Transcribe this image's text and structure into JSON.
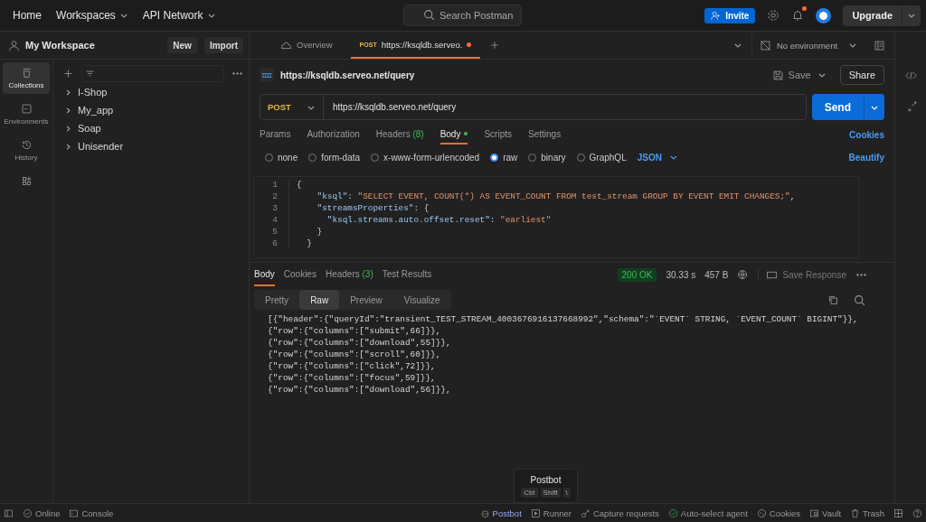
{
  "top_nav": {
    "links": [
      {
        "label": "Home",
        "dropdown": false
      },
      {
        "label": "Workspaces",
        "dropdown": true
      },
      {
        "label": "API Network",
        "dropdown": true
      }
    ],
    "search": {
      "placeholder": "Search Postman"
    },
    "invite": "Invite",
    "notifications_unread": true,
    "upgrade": "Upgrade"
  },
  "workspace": {
    "name": "My Workspace",
    "buttons": [
      "New",
      "Import"
    ]
  },
  "rail": [
    {
      "kind": "collections",
      "label": "Collections",
      "selected": true
    },
    {
      "kind": "environments",
      "label": "Environments",
      "selected": false
    },
    {
      "kind": "history",
      "label": "History",
      "selected": false
    },
    {
      "kind": "apps",
      "selected": false
    }
  ],
  "collections": [
    {
      "name": "I-Shop",
      "expanded": false
    },
    {
      "name": "My_app",
      "expanded": false
    },
    {
      "name": "Soap",
      "expanded": false
    },
    {
      "name": "Unisender",
      "expanded": false
    }
  ],
  "tabs": [
    {
      "kind": "overview",
      "label": "Overview",
      "selected": false
    },
    {
      "kind": "request",
      "method": "POST",
      "label": "https://ksqldb.serveo.",
      "unsaved": true,
      "selected": true
    }
  ],
  "environment": "No environment",
  "request": {
    "title": "https://ksqldb.serveo.net/query",
    "save": "Save",
    "share": "Share",
    "method": "POST",
    "url": "https://ksqldb.serveo.net/query",
    "send": "Send"
  },
  "request_tabs": [
    {
      "label": "Params",
      "selected": false
    },
    {
      "label": "Authorization",
      "selected": false
    },
    {
      "label": "Headers",
      "count": "(8)",
      "selected": false
    },
    {
      "label": "Body",
      "dot": true,
      "selected": true
    },
    {
      "label": "Scripts",
      "selected": false
    },
    {
      "label": "Settings",
      "selected": false
    }
  ],
  "cookies_link": "Cookies",
  "body_types": [
    {
      "label": "none",
      "selected": false
    },
    {
      "label": "form-data",
      "selected": false
    },
    {
      "label": "x-www-form-urlencoded",
      "selected": false
    },
    {
      "label": "raw",
      "selected": true
    },
    {
      "label": "binary",
      "selected": false
    },
    {
      "label": "GraphQL",
      "selected": false
    }
  ],
  "body_format": "JSON",
  "beautify": "Beautify",
  "code_lines": [
    {
      "number": "1",
      "tokens": [
        {
          "kind": "punct",
          "text": "{"
        }
      ]
    },
    {
      "number": "2",
      "tokens": [
        {
          "kind": "key",
          "text": "    \"ksql\""
        },
        {
          "kind": "punct",
          "text": ": "
        },
        {
          "kind": "string",
          "text": "\"SELECT EVENT, COUNT(*) AS EVENT_COUNT FROM test_stream GROUP BY EVENT EMIT CHANGES;\""
        },
        {
          "kind": "punct",
          "text": ","
        }
      ]
    },
    {
      "number": "3",
      "tokens": [
        {
          "kind": "key",
          "text": "    \"streamsProperties\""
        },
        {
          "kind": "punct",
          "text": ": {"
        }
      ]
    },
    {
      "number": "4",
      "tokens": [
        {
          "kind": "key",
          "text": "      \"ksql.streams.auto.offset.reset\""
        },
        {
          "kind": "punct",
          "text": ": "
        },
        {
          "kind": "string",
          "text": "\"earliest\""
        }
      ]
    },
    {
      "number": "5",
      "tokens": [
        {
          "kind": "punct",
          "text": "    }"
        }
      ]
    },
    {
      "number": "6",
      "tokens": [
        {
          "kind": "punct",
          "text": "  }"
        }
      ]
    }
  ],
  "response_tabs": [
    {
      "label": "Body",
      "selected": true
    },
    {
      "label": "Cookies",
      "selected": false
    },
    {
      "label": "Headers",
      "count": "(3)",
      "selected": false
    },
    {
      "label": "Test Results",
      "selected": false
    }
  ],
  "response_status": {
    "code": "200 OK",
    "time": "30.33 s",
    "size": "457 B",
    "save": "Save Response"
  },
  "view_tabs": [
    {
      "label": "Pretty",
      "selected": false
    },
    {
      "label": "Raw",
      "selected": true
    },
    {
      "label": "Preview",
      "selected": false
    },
    {
      "label": "Visualize",
      "selected": false
    }
  ],
  "response_lines": [
    "[{\"header\":{\"queryId\":\"transient_TEST_STREAM_4003676916137668992\",\"schema\":\"`EVENT` STRING, `EVENT_COUNT` BIGINT\"}},",
    "{\"row\":{\"columns\":[\"submit\",66]}},",
    "{\"row\":{\"columns\":[\"download\",55]}},",
    "{\"row\":{\"columns\":[\"scroll\",60]}},",
    "{\"row\":{\"columns\":[\"click\",72]}},",
    "{\"row\":{\"columns\":[\"focus\",59]}},",
    "{\"row\":{\"columns\":[\"download\",56]}},"
  ],
  "tooltip": {
    "title": "Postbot",
    "keys": [
      "Ctrl",
      "Shift",
      "\\"
    ]
  },
  "status_left": [
    {
      "kind": "online",
      "label": "Online"
    },
    {
      "kind": "console",
      "label": "Console"
    }
  ],
  "status_right": [
    {
      "kind": "postbot",
      "label": "Postbot"
    },
    {
      "kind": "runner",
      "label": "Runner"
    },
    {
      "kind": "capture",
      "label": "Capture requests"
    },
    {
      "kind": "agent",
      "label": "Auto-select agent"
    },
    {
      "kind": "cookies",
      "label": "Cookies"
    },
    {
      "kind": "vault",
      "label": "Vault"
    },
    {
      "kind": "trash",
      "label": "Trash"
    }
  ]
}
